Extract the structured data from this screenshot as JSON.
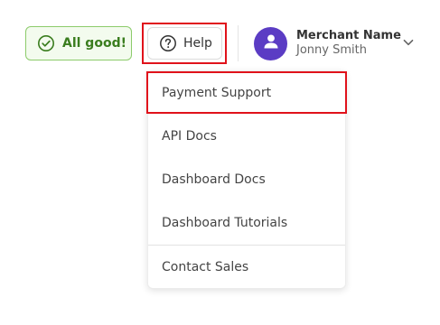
{
  "status": {
    "text": "All good!",
    "icon": "check-circle-icon",
    "color": "#3a7d1e"
  },
  "help": {
    "label": "Help",
    "icon": "question-circle-icon"
  },
  "user": {
    "merchant_label": "Merchant Name",
    "name": "Jonny Smith",
    "avatar_color": "#5b3cc4",
    "icon": "user-icon"
  },
  "menu": {
    "items": [
      {
        "label": "Payment Support"
      },
      {
        "label": "API Docs"
      },
      {
        "label": "Dashboard Docs"
      },
      {
        "label": "Dashboard Tutorials"
      },
      {
        "label": "Contact Sales"
      }
    ]
  },
  "highlight_color": "#e0121b"
}
